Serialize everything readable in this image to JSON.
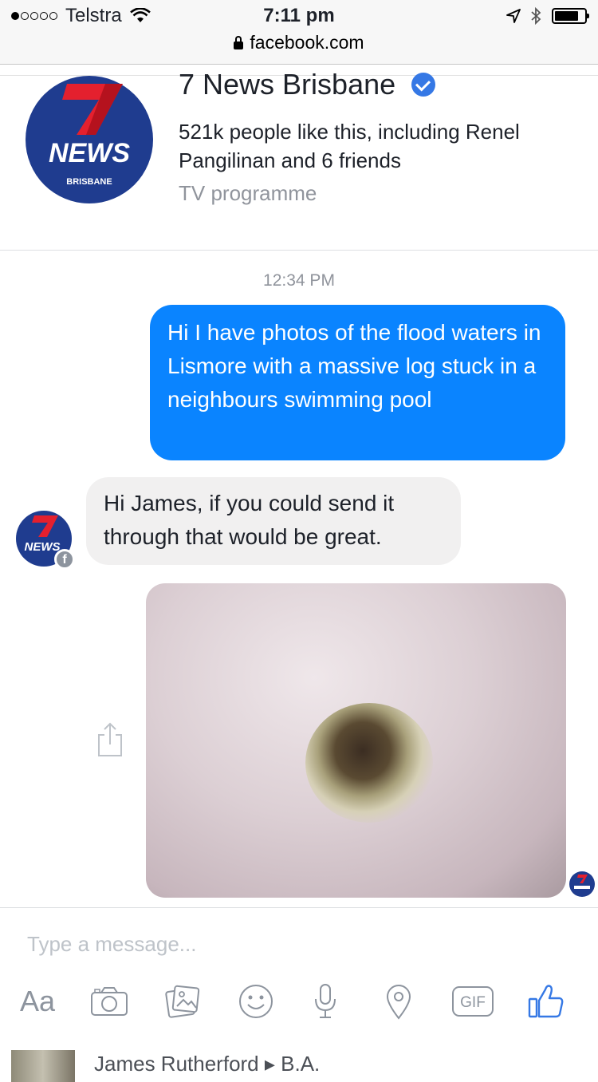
{
  "status_bar": {
    "carrier": "Telstra",
    "time": "7:11 pm",
    "signal_bars_filled": 1,
    "signal_bars_total": 5
  },
  "browser": {
    "url": "facebook.com"
  },
  "page": {
    "name": "7 News Brisbane",
    "likes_text": "521k people like this, including Renel Pangilinan and 6 friends",
    "category": "TV programme",
    "logo": {
      "top_text": "7",
      "main_text": "NEWS",
      "sub_text": "BRISBANE"
    }
  },
  "conversation": {
    "timestamp": "12:34 PM",
    "messages": [
      {
        "from": "user",
        "text": "Hi I have photos of the flood waters in Lismore with a massive log stuck in a neighbours swimming pool"
      },
      {
        "from": "page",
        "text": "Hi James, if you could send it through that would be great."
      }
    ]
  },
  "composer": {
    "placeholder": "Type a message...",
    "tools": [
      "text-format-icon",
      "camera-icon",
      "gallery-icon",
      "emoji-icon",
      "microphone-icon",
      "location-icon",
      "gif-icon",
      "like-icon"
    ],
    "aa_label": "Aa",
    "gif_label": "GIF"
  },
  "feed_peek": {
    "text": "James Rutherford ▸ B.A."
  },
  "colors": {
    "outgoing_bubble": "#0a84ff",
    "incoming_bubble": "#f1f0f0",
    "logo_blue": "#1f3c8f",
    "logo_red": "#e4202e",
    "verified_blue": "#3578e5",
    "like_blue": "#3578e5"
  }
}
